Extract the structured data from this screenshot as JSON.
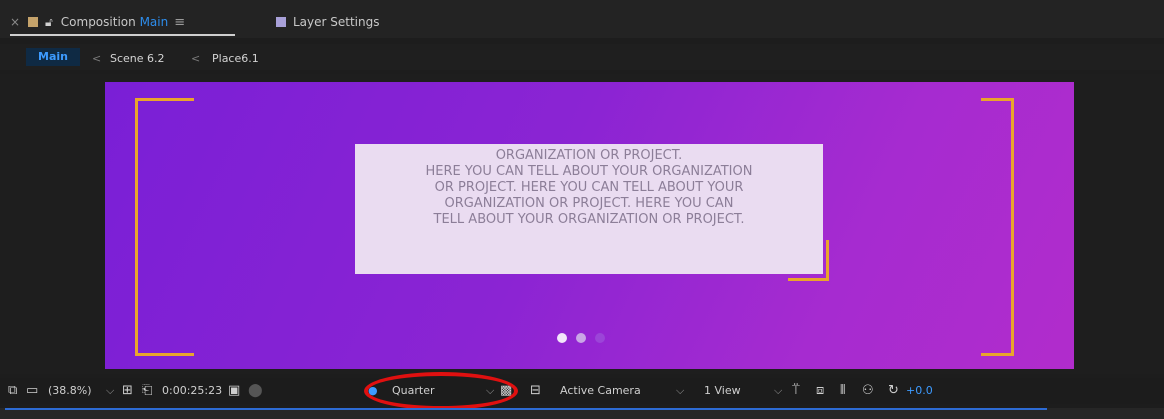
{
  "tabs": {
    "composition": {
      "close": "×",
      "prefix": "Composition",
      "name": "Main",
      "menu": "≡",
      "swatch_color": "#c5a36b"
    },
    "layer": {
      "label": "Layer Settings",
      "swatch_color": "#a8a0d8"
    }
  },
  "breadcrumb": {
    "items": [
      "Main",
      "Scene 6.2",
      "Place6.1"
    ],
    "separator": "<"
  },
  "canvas": {
    "text_lines": [
      "ORGANIZATION OR PROJECT.",
      "HERE YOU CAN TELL ABOUT YOUR ORGANIZATION",
      "OR PROJECT.  HERE YOU CAN TELL ABOUT YOUR",
      "ORGANIZATION OR PROJECT. HERE YOU CAN",
      "TELL ABOUT YOUR ORGANIZATION OR PROJECT."
    ],
    "accent_color": "#e9a52c",
    "background_colors": [
      "#7a1fd6",
      "#b12ccc"
    ],
    "pagination": {
      "count": 3,
      "active": 1
    }
  },
  "toolbar": {
    "zoom": "(38.8%)",
    "timecode": "0:00:25:23",
    "resolution": "Quarter",
    "camera": "Active Camera",
    "views": "1 View",
    "exposure": "+0.0",
    "highlight_color": "#e01010"
  }
}
